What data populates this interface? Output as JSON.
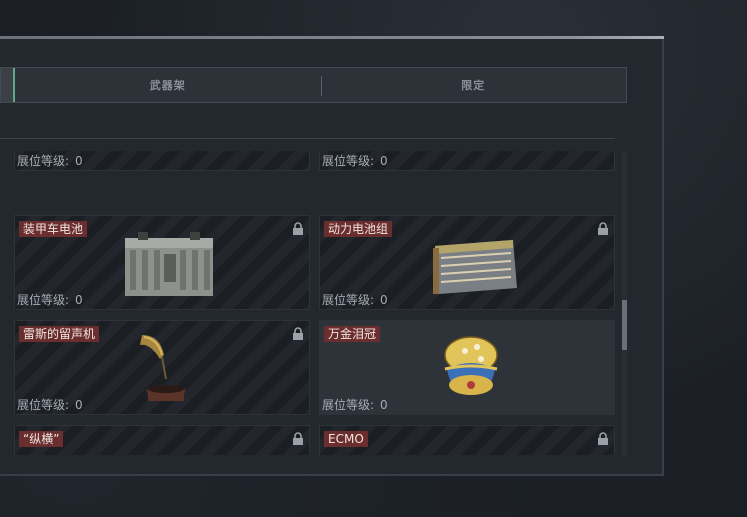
{
  "tabs": [
    {
      "label": ""
    },
    {
      "label": "武器架"
    },
    {
      "label": "限定"
    }
  ],
  "level_label": "展位等级:",
  "cards": [
    {
      "name": "",
      "level": "0",
      "locked": false
    },
    {
      "name": "",
      "level": "0",
      "locked": false
    },
    {
      "name": "装甲车电池",
      "level": "0",
      "locked": true,
      "icon": "battery-icon"
    },
    {
      "name": "动力电池组",
      "level": "0",
      "locked": true,
      "icon": "battery-pack-icon"
    },
    {
      "name": "雷斯的留声机",
      "level": "0",
      "locked": true,
      "icon": "gramophone-icon"
    },
    {
      "name": "万金泪冠",
      "level": "0",
      "locked": false,
      "icon": "jeweled-egg-icon"
    },
    {
      "name": "“纵横”",
      "level": "",
      "locked": true,
      "icon": "chessboard-icon"
    },
    {
      "name": "ECMO",
      "level": "",
      "locked": true,
      "icon": "ecmo-machine-icon"
    }
  ],
  "colors": {
    "name_tag": "#6b2e2e",
    "active_tab": "#5fa88a"
  }
}
